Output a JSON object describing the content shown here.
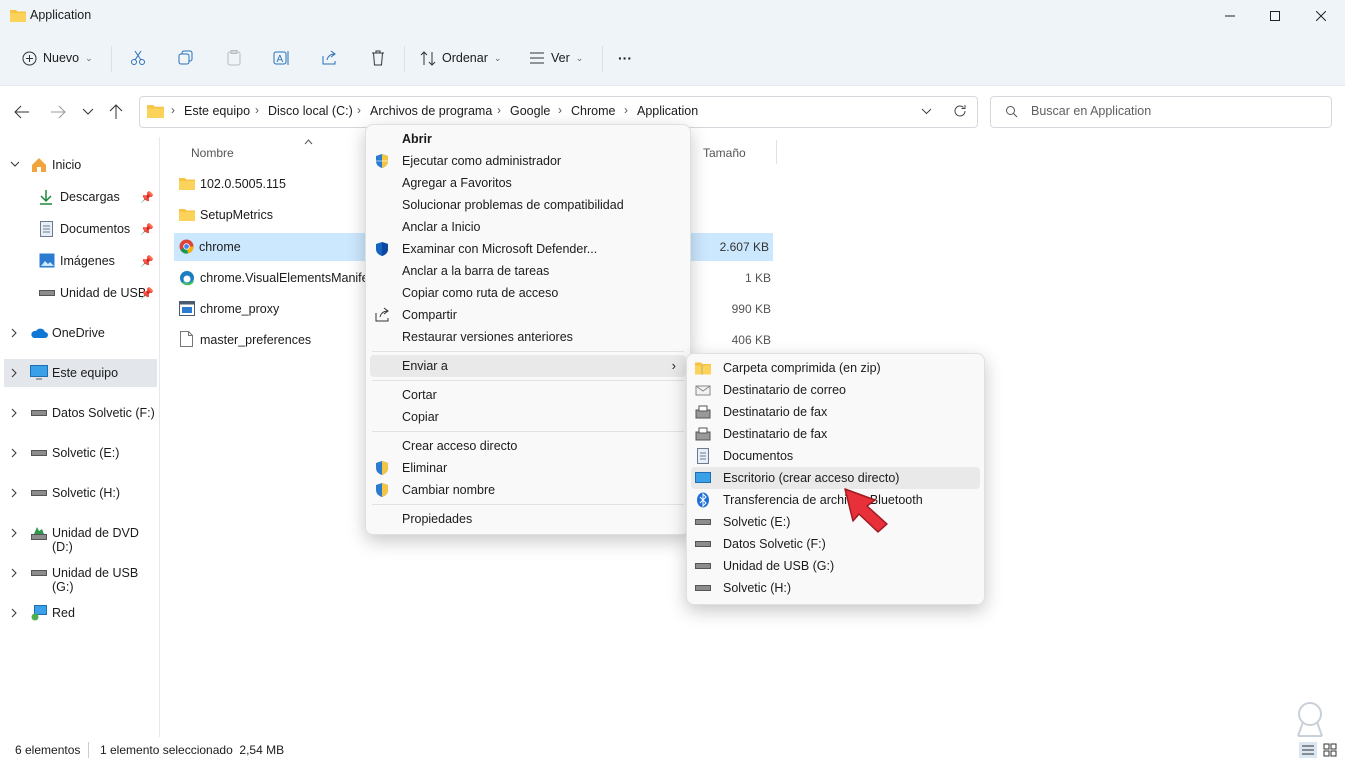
{
  "window": {
    "title": "Application"
  },
  "toolbar": {
    "new_label": "Nuevo",
    "sort_label": "Ordenar",
    "view_label": "Ver",
    "more_label": "···"
  },
  "breadcrumbs": [
    "Este equipo",
    "Disco local (C:)",
    "Archivos de programa",
    "Google",
    "Chrome",
    "Application"
  ],
  "search": {
    "placeholder": "Buscar en Application"
  },
  "sidebar": {
    "items": [
      {
        "label": "Inicio"
      },
      {
        "label": "Descargas"
      },
      {
        "label": "Documentos"
      },
      {
        "label": "Imágenes"
      },
      {
        "label": "Unidad de USB"
      },
      {
        "label": "OneDrive"
      },
      {
        "label": "Este equipo"
      },
      {
        "label": "Datos Solvetic (F:)"
      },
      {
        "label": "Solvetic (E:)"
      },
      {
        "label": "Solvetic (H:)"
      },
      {
        "label": "Unidad de DVD (D:)"
      },
      {
        "label": "Unidad de USB (G:)"
      },
      {
        "label": "Red"
      }
    ]
  },
  "columns": {
    "name": "Nombre",
    "size": "Tamaño"
  },
  "files": [
    {
      "name": "102.0.5005.115",
      "size": ""
    },
    {
      "name": "SetupMetrics",
      "size": ""
    },
    {
      "name": "chrome",
      "size": "2.607 KB"
    },
    {
      "name": "chrome.VisualElementsManifest",
      "size": "1 KB"
    },
    {
      "name": "chrome_proxy",
      "size": "990 KB"
    },
    {
      "name": "master_preferences",
      "size": "406 KB"
    }
  ],
  "context_menu": {
    "items": [
      "Abrir",
      "Ejecutar como administrador",
      "Agregar a Favoritos",
      "Solucionar problemas de compatibilidad",
      "Anclar a Inicio",
      "Examinar con Microsoft Defender...",
      "Anclar a la barra de tareas",
      "Copiar como ruta de acceso",
      "Compartir",
      "Restaurar versiones anteriores",
      "Enviar a",
      "Cortar",
      "Copiar",
      "Crear acceso directo",
      "Eliminar",
      "Cambiar nombre",
      "Propiedades"
    ]
  },
  "sendto_menu": {
    "items": [
      "Carpeta comprimida (en zip)",
      "Destinatario de correo",
      "Destinatario de fax",
      "Destinatario de fax",
      "Documentos",
      "Escritorio (crear acceso directo)",
      "Transferencia de archivos Bluetooth",
      "Solvetic (E:)",
      "Datos Solvetic (F:)",
      "Unidad de USB (G:)",
      "Solvetic (H:)"
    ]
  },
  "status": {
    "count": "6 elementos",
    "selected": "1 elemento seleccionado  2,54 MB"
  },
  "colors": {
    "accent": "#0067c0",
    "selection": "#cce8ff",
    "folder": "#f6c343",
    "arrow": "#e8303a"
  }
}
